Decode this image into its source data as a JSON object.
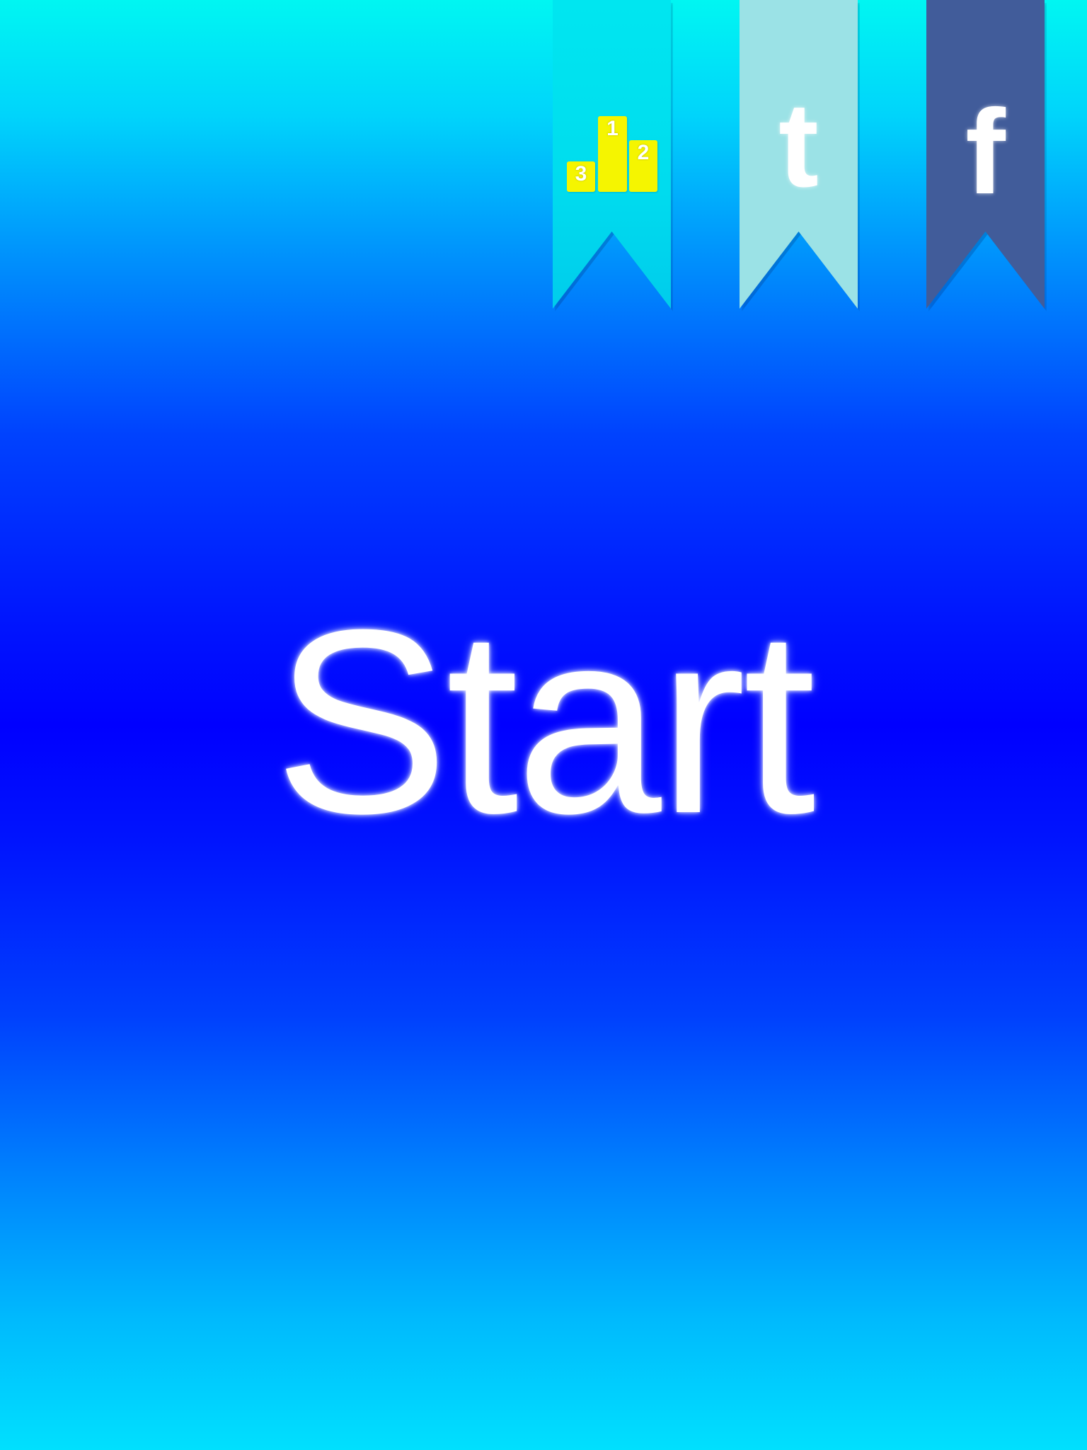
{
  "buttons": {
    "start_label": "Start",
    "leaderboard": {
      "icon": "podium-icon",
      "color": "#00dcee",
      "places": {
        "first": "1",
        "second": "2",
        "third": "3"
      },
      "place_color": "#f5f500"
    },
    "tumblr": {
      "icon": "tumblr-icon",
      "glyph": "t",
      "color": "#9be2e6"
    },
    "facebook": {
      "icon": "facebook-icon",
      "glyph": "f",
      "color": "#415c9a"
    }
  },
  "background": {
    "top_color": "#00f6f2",
    "center_color": "#0000ff",
    "bottom_color": "#00e0fe"
  }
}
